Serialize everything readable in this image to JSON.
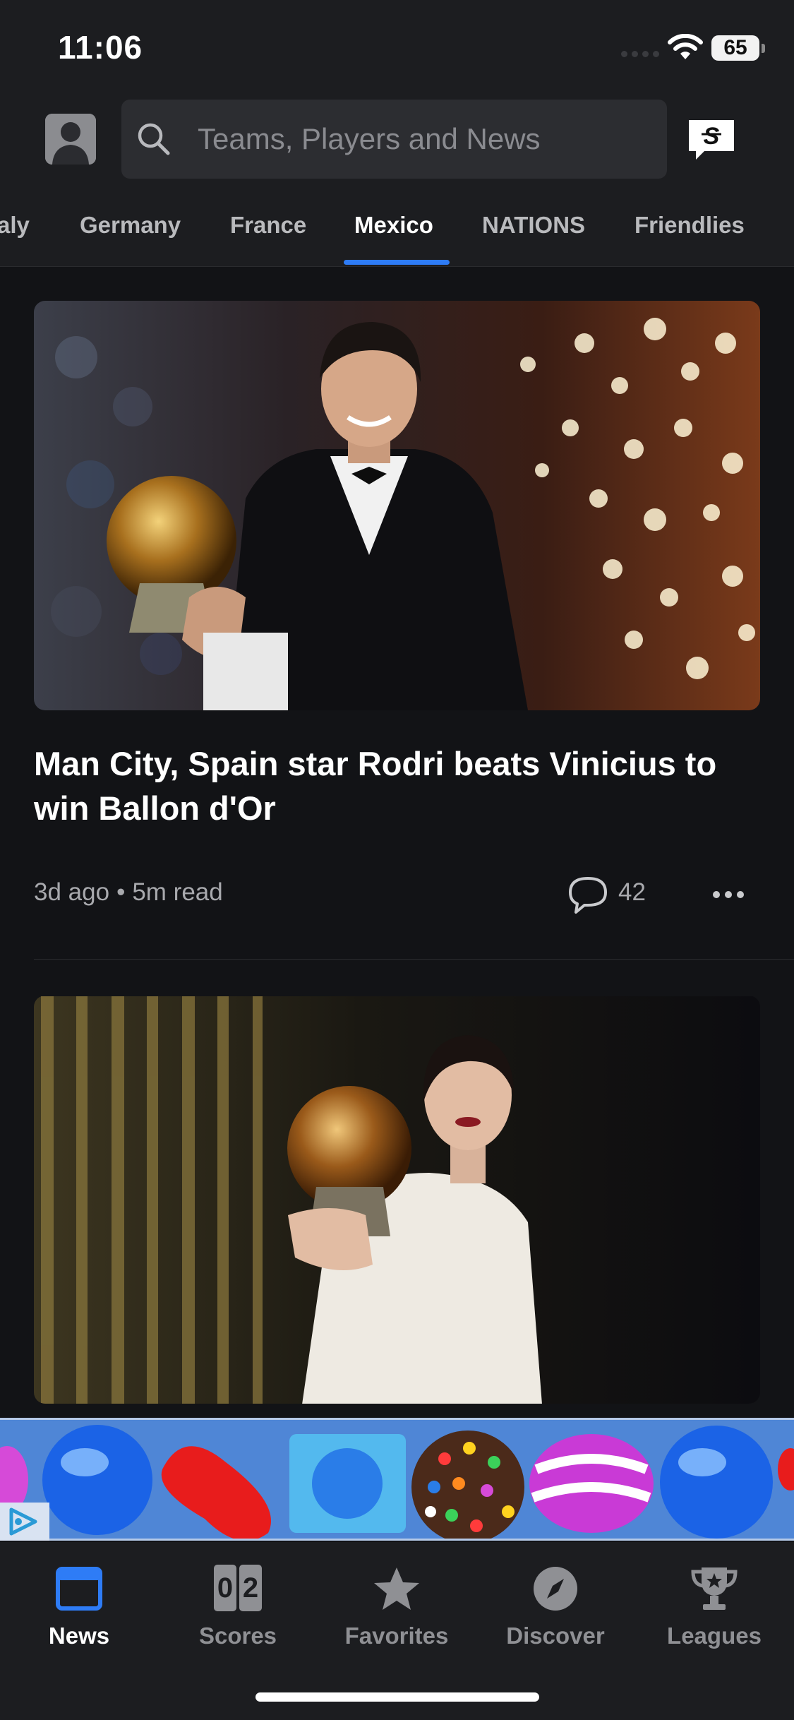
{
  "status_bar": {
    "time": "11:06",
    "battery": "65"
  },
  "header": {
    "search_placeholder": "Teams, Players and News"
  },
  "tabs": [
    {
      "label": "aly"
    },
    {
      "label": "Germany"
    },
    {
      "label": "France"
    },
    {
      "label": "Mexico",
      "active": true
    },
    {
      "label": "NATIONS"
    },
    {
      "label": "Friendlies"
    }
  ],
  "feed": {
    "articles": [
      {
        "headline": "Man City, Spain star Rodri beats Vinicius to win Ballon d'Or",
        "age": "3d ago",
        "read_time": "5m read",
        "separator": "•",
        "comments": "42"
      }
    ]
  },
  "tabbar": {
    "items": [
      {
        "label": "News",
        "icon": "news-icon",
        "active": true
      },
      {
        "label": "Scores",
        "icon": "scores-icon",
        "digits": [
          "0",
          "2"
        ]
      },
      {
        "label": "Favorites",
        "icon": "star-icon"
      },
      {
        "label": "Discover",
        "icon": "compass-icon"
      },
      {
        "label": "Leagues",
        "icon": "trophy-icon"
      }
    ]
  },
  "colors": {
    "background": "#121316",
    "chrome": "#1c1d20",
    "accent": "#2e7cf6"
  }
}
